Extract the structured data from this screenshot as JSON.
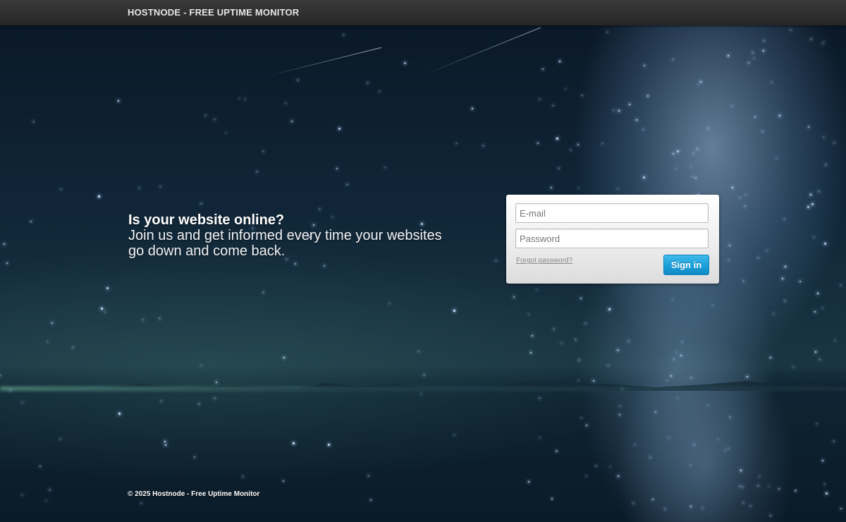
{
  "header": {
    "brand": "HOSTNODE - FREE UPTIME MONITOR"
  },
  "hero": {
    "heading": "Is your website online?",
    "text": "Join us and get informed every time your websites go down and come back."
  },
  "login": {
    "email_placeholder": "E-mail",
    "email_value": "",
    "password_placeholder": "Password",
    "password_value": "",
    "forgot_label": "Forgot password?",
    "signin_label": "Sign in"
  },
  "footer": {
    "copyright": "© 2025 Hostnode - Free Uptime Monitor"
  },
  "colors": {
    "topbar": "#2e2e2e",
    "signin_button": "#1a9fd9",
    "panel": "#eeeeee"
  }
}
